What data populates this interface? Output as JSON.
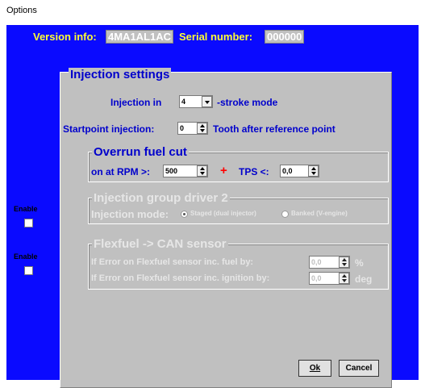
{
  "window": {
    "title": "Options"
  },
  "header": {
    "version_label": "Version info:",
    "version_value": "4MA1AL1AC",
    "serial_label": "Serial number:",
    "serial_value": "000000"
  },
  "injection": {
    "title": "Injection settings",
    "injection_in_label": "Injection in",
    "stroke_value": "4",
    "stroke_suffix": "-stroke mode",
    "startpoint_label": "Startpoint injection:",
    "startpoint_value": "0",
    "startpoint_suffix": "Tooth after reference point"
  },
  "overrun": {
    "title": "Overrun fuel cut",
    "rpm_label": "on at RPM  >:",
    "rpm_value": "500",
    "plus": "+",
    "tps_label": "TPS <:",
    "tps_value": "0,0"
  },
  "group_driver": {
    "enable_label": "Enable",
    "title": "Injection group driver 2",
    "mode_label": "Injection mode:",
    "option_staged": "Staged (dual injector)",
    "option_banked": "Banked (V-engine)"
  },
  "flexfuel": {
    "enable_label": "Enable",
    "title": "Flexfuel -> CAN sensor",
    "fuel_label": "If Error on Flexfuel sensor inc. fuel by:",
    "fuel_value": "0,0",
    "fuel_unit": "%",
    "ign_label": "If Error on Flexfuel sensor inc. ignition by:",
    "ign_value": "0,0",
    "ign_unit": "deg"
  },
  "buttons": {
    "ok": "Ok",
    "cancel": "Cancel"
  }
}
